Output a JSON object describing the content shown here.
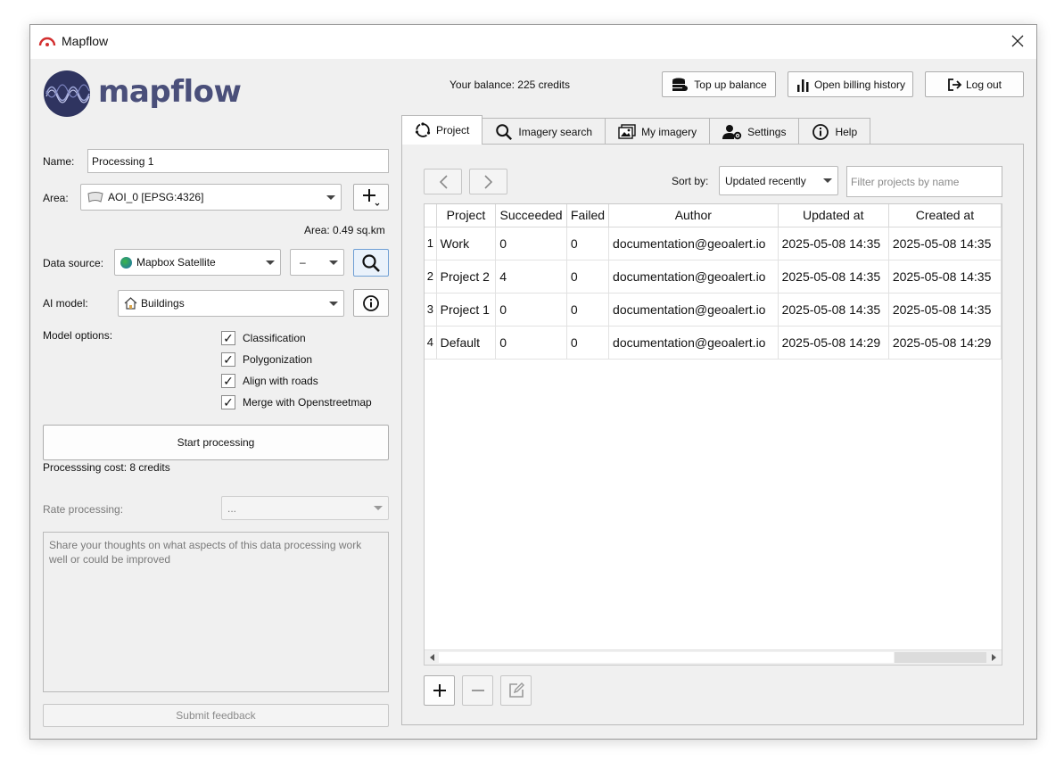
{
  "window": {
    "title": "Mapflow"
  },
  "logo": {
    "text": "mapflow"
  },
  "header": {
    "balance": "Your balance: 225 credits",
    "top_up": "Top up balance",
    "billing": "Open billing history",
    "logout": "Log out"
  },
  "form": {
    "name_label": "Name:",
    "name_value": "Processing 1",
    "area_label": "Area:",
    "area_value": "AOI_0 [EPSG:4326]",
    "area_size": "Area: 0.49 sq.km",
    "datasource_label": "Data source:",
    "datasource_value": "Mapbox Satellite",
    "zoom_value": "–",
    "model_label": "AI model:",
    "model_value": "Buildings",
    "options_label": "Model options:",
    "options": [
      {
        "label": "Classification",
        "checked": true
      },
      {
        "label": "Polygonization",
        "checked": true
      },
      {
        "label": "Align with roads",
        "checked": true
      },
      {
        "label": "Merge with Openstreetmap",
        "checked": true
      }
    ],
    "start_button": "Start processing",
    "cost": "Processsing cost: 8 credits",
    "rate_label": "Rate processing:",
    "rate_value": "...",
    "feedback_placeholder": "Share your thoughts on what aspects of this data processing work well or could be improved",
    "submit_feedback": "Submit feedback"
  },
  "tabs": [
    {
      "label": "Project",
      "icon": "project-icon",
      "active": true
    },
    {
      "label": "Imagery search",
      "icon": "search-icon",
      "active": false
    },
    {
      "label": "My imagery",
      "icon": "image-icon",
      "active": false
    },
    {
      "label": "Settings",
      "icon": "user-settings-icon",
      "active": false
    },
    {
      "label": "Help",
      "icon": "info-icon",
      "active": false
    }
  ],
  "projects": {
    "sort_label": "Sort by:",
    "sort_value": "Updated recently",
    "filter_placeholder": "Filter projects by name",
    "columns": [
      "Project",
      "Succeeded",
      "Failed",
      "Author",
      "Updated at",
      "Created at"
    ],
    "rows": [
      {
        "num": "1",
        "project": "Work",
        "succeeded": "0",
        "failed": "0",
        "author": "documentation@geoalert.io",
        "updated": "2025-05-08 14:35",
        "created": "2025-05-08 14:35"
      },
      {
        "num": "2",
        "project": "Project 2",
        "succeeded": "4",
        "failed": "0",
        "author": "documentation@geoalert.io",
        "updated": "2025-05-08 14:35",
        "created": "2025-05-08 14:35"
      },
      {
        "num": "3",
        "project": "Project 1",
        "succeeded": "0",
        "failed": "0",
        "author": "documentation@geoalert.io",
        "updated": "2025-05-08 14:35",
        "created": "2025-05-08 14:35"
      },
      {
        "num": "4",
        "project": "Default",
        "succeeded": "0",
        "failed": "0",
        "author": "documentation@geoalert.io",
        "updated": "2025-05-08 14:29",
        "created": "2025-05-08 14:29"
      }
    ]
  },
  "colors": {
    "brand": "#4a4f7a",
    "accent": "#d32f2f",
    "window_bg": "#f0f0f0"
  }
}
